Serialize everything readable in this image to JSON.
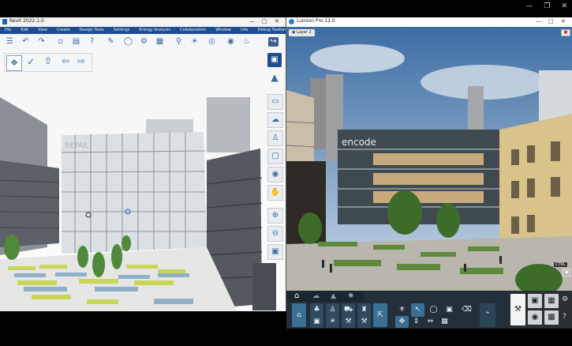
{
  "revit": {
    "title": "Revit 2022.1.0",
    "menu": [
      "File",
      "Edit",
      "View",
      "Create",
      "Design Tools",
      "Settings",
      "Energy Analysis",
      "Collaboration",
      "Window",
      "Info",
      "Debug Toolbar Plugin"
    ],
    "watermark": "RETAIL"
  },
  "lumion": {
    "title": "Lumion Pro 12.0",
    "layer_label": "Layer 2",
    "building_sign": "encode",
    "camera_label": "CTRL"
  },
  "colors": {
    "revit_menubar": "#1d4d8f",
    "lumion_panel": "#23303a",
    "lumion_button": "#2e4a5e",
    "lumion_highlight": "#3a6f96"
  }
}
